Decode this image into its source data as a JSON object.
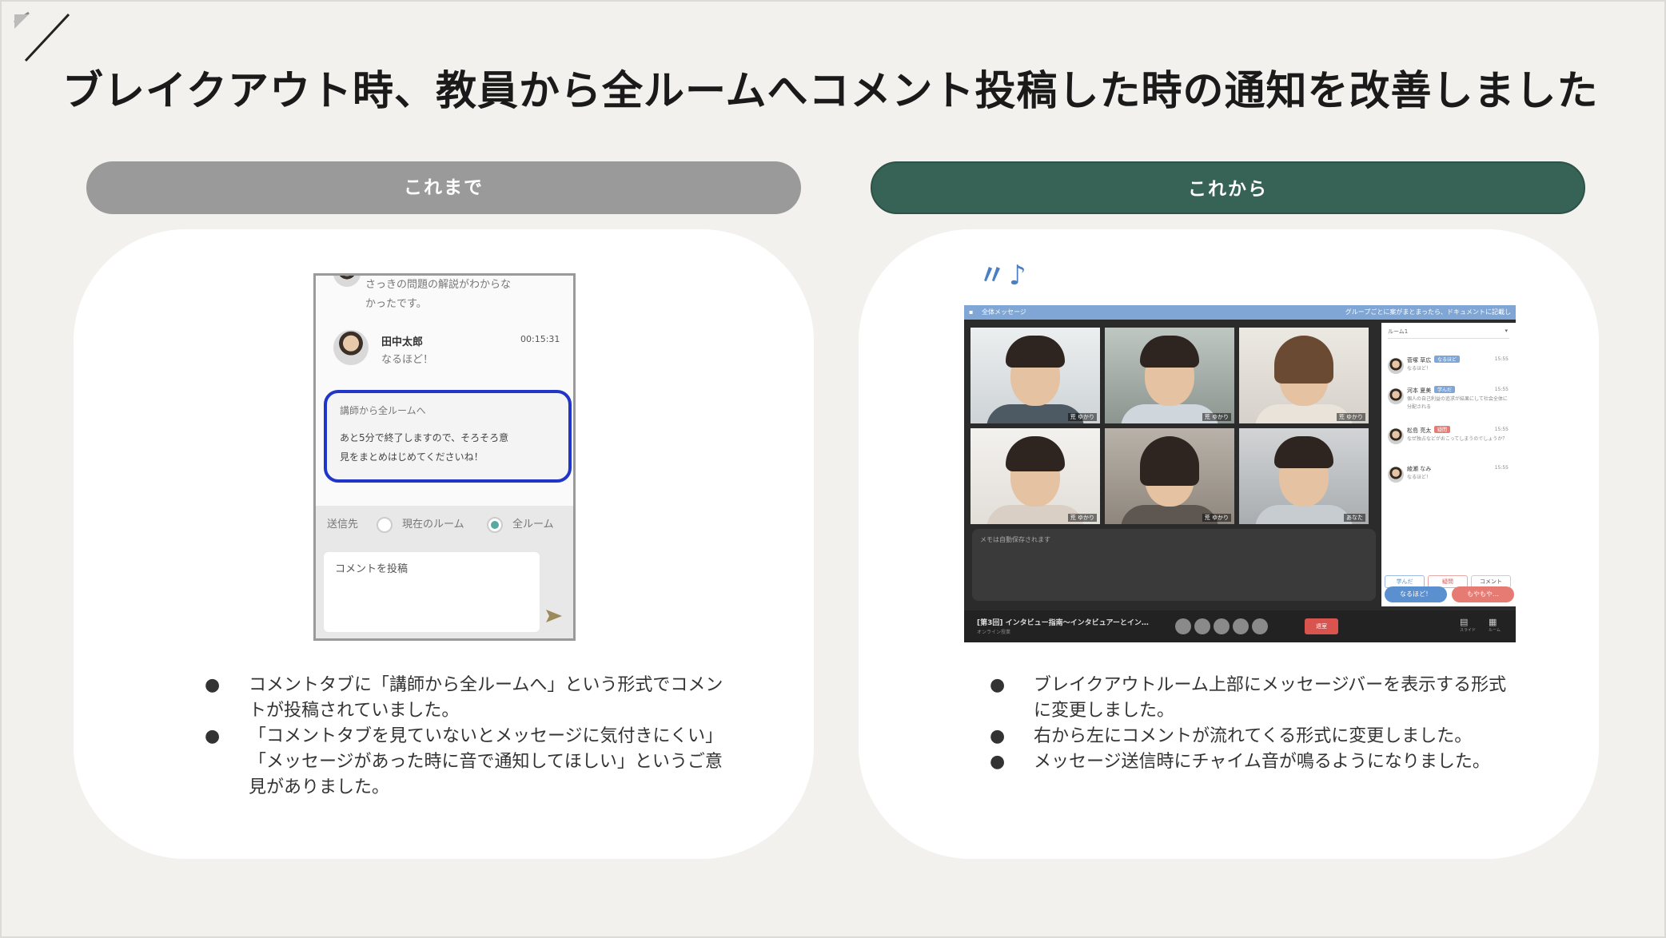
{
  "title": "ブレイクアウト時、教員から全ルームへコメント投稿した時の通知を改善しました",
  "before": {
    "label": "これまで",
    "phone": {
      "prev_message_line1": "さっきの問題の解説がわからな",
      "prev_message_line2": "かったです。",
      "user_name": "田中太郎",
      "time": "00:15:31",
      "reply": "なるほど！",
      "highlight_header": "講師から全ルームへ",
      "highlight_line1": "あと5分で終了しますので、そろそろ意",
      "highlight_line2": "見をまとめはじめてくださいね！",
      "send_to_label": "送信先",
      "radio_current": "現在のルーム",
      "radio_all": "全ルーム",
      "radio_selected": "全ルーム",
      "comment_placeholder": "コメントを投稿",
      "accent_color": "#1f36c9"
    },
    "bullets": [
      "コメントタブに「講師から全ルームへ」という形式でコメントが投稿されていました。",
      "「コメントタブを見ていないとメッセージに気付きにくい」「メッセージがあった時に音で通知してほしい」というご意見がありました。"
    ]
  },
  "after": {
    "label": "これから",
    "notes": "〃♪〃",
    "screen": {
      "message_bar_label": "全体メッセージ",
      "message_bar_text": "グループごとに案がまとまったら、ドキュメントに記載し",
      "room_select": "ルーム1",
      "tile_tags": [
        "荒 ゆかり",
        "荒 ゆかり",
        "荒 ゆかり",
        "荒 ゆかり",
        "荒 ゆかり",
        "あなた"
      ],
      "comments": [
        {
          "name": "菅塚 草広",
          "badge": "なるほど",
          "time": "15:55",
          "text": "なるほど！"
        },
        {
          "name": "河本 夏美",
          "badge": "学んだ",
          "time": "15:55",
          "text": "個人の自己利益の追求が結果にして社会全体に分配される"
        },
        {
          "name": "松島 亮太",
          "badge": "疑問",
          "time": "15:55",
          "text": "なぜ独占などがおこってしまうのでしょうか？"
        },
        {
          "name": "綾瀬 なみ",
          "badge": "",
          "time": "15:55",
          "text": "なるほど！"
        }
      ],
      "side_buttons": [
        "学んだ",
        "疑問",
        "コメント"
      ],
      "reactions": [
        "なるほど！",
        "もやもや…"
      ],
      "memo_placeholder": "メモは自動保存されます",
      "course_title": "[第3回] インタビュー指南〜インタビュアーとイン…",
      "course_sub": "オンライン授業",
      "leave_label": "退室",
      "footer_icons": [
        {
          "icon": "slide-icon",
          "label": "スライド"
        },
        {
          "icon": "grid-icon",
          "label": "ルーム"
        }
      ],
      "bar_color": "#7fa6d4"
    },
    "bullets": [
      "ブレイクアウトルーム上部にメッセージバーを表示する形式に変更しました。",
      "右から左にコメントが流れてくる形式に変更しました。",
      "メッセージ送信時にチャイム音が鳴るようになりました。"
    ]
  },
  "colors": {
    "before_pill": "#9a9a9a",
    "after_pill": "#376356",
    "background": "#f2f1ee"
  }
}
